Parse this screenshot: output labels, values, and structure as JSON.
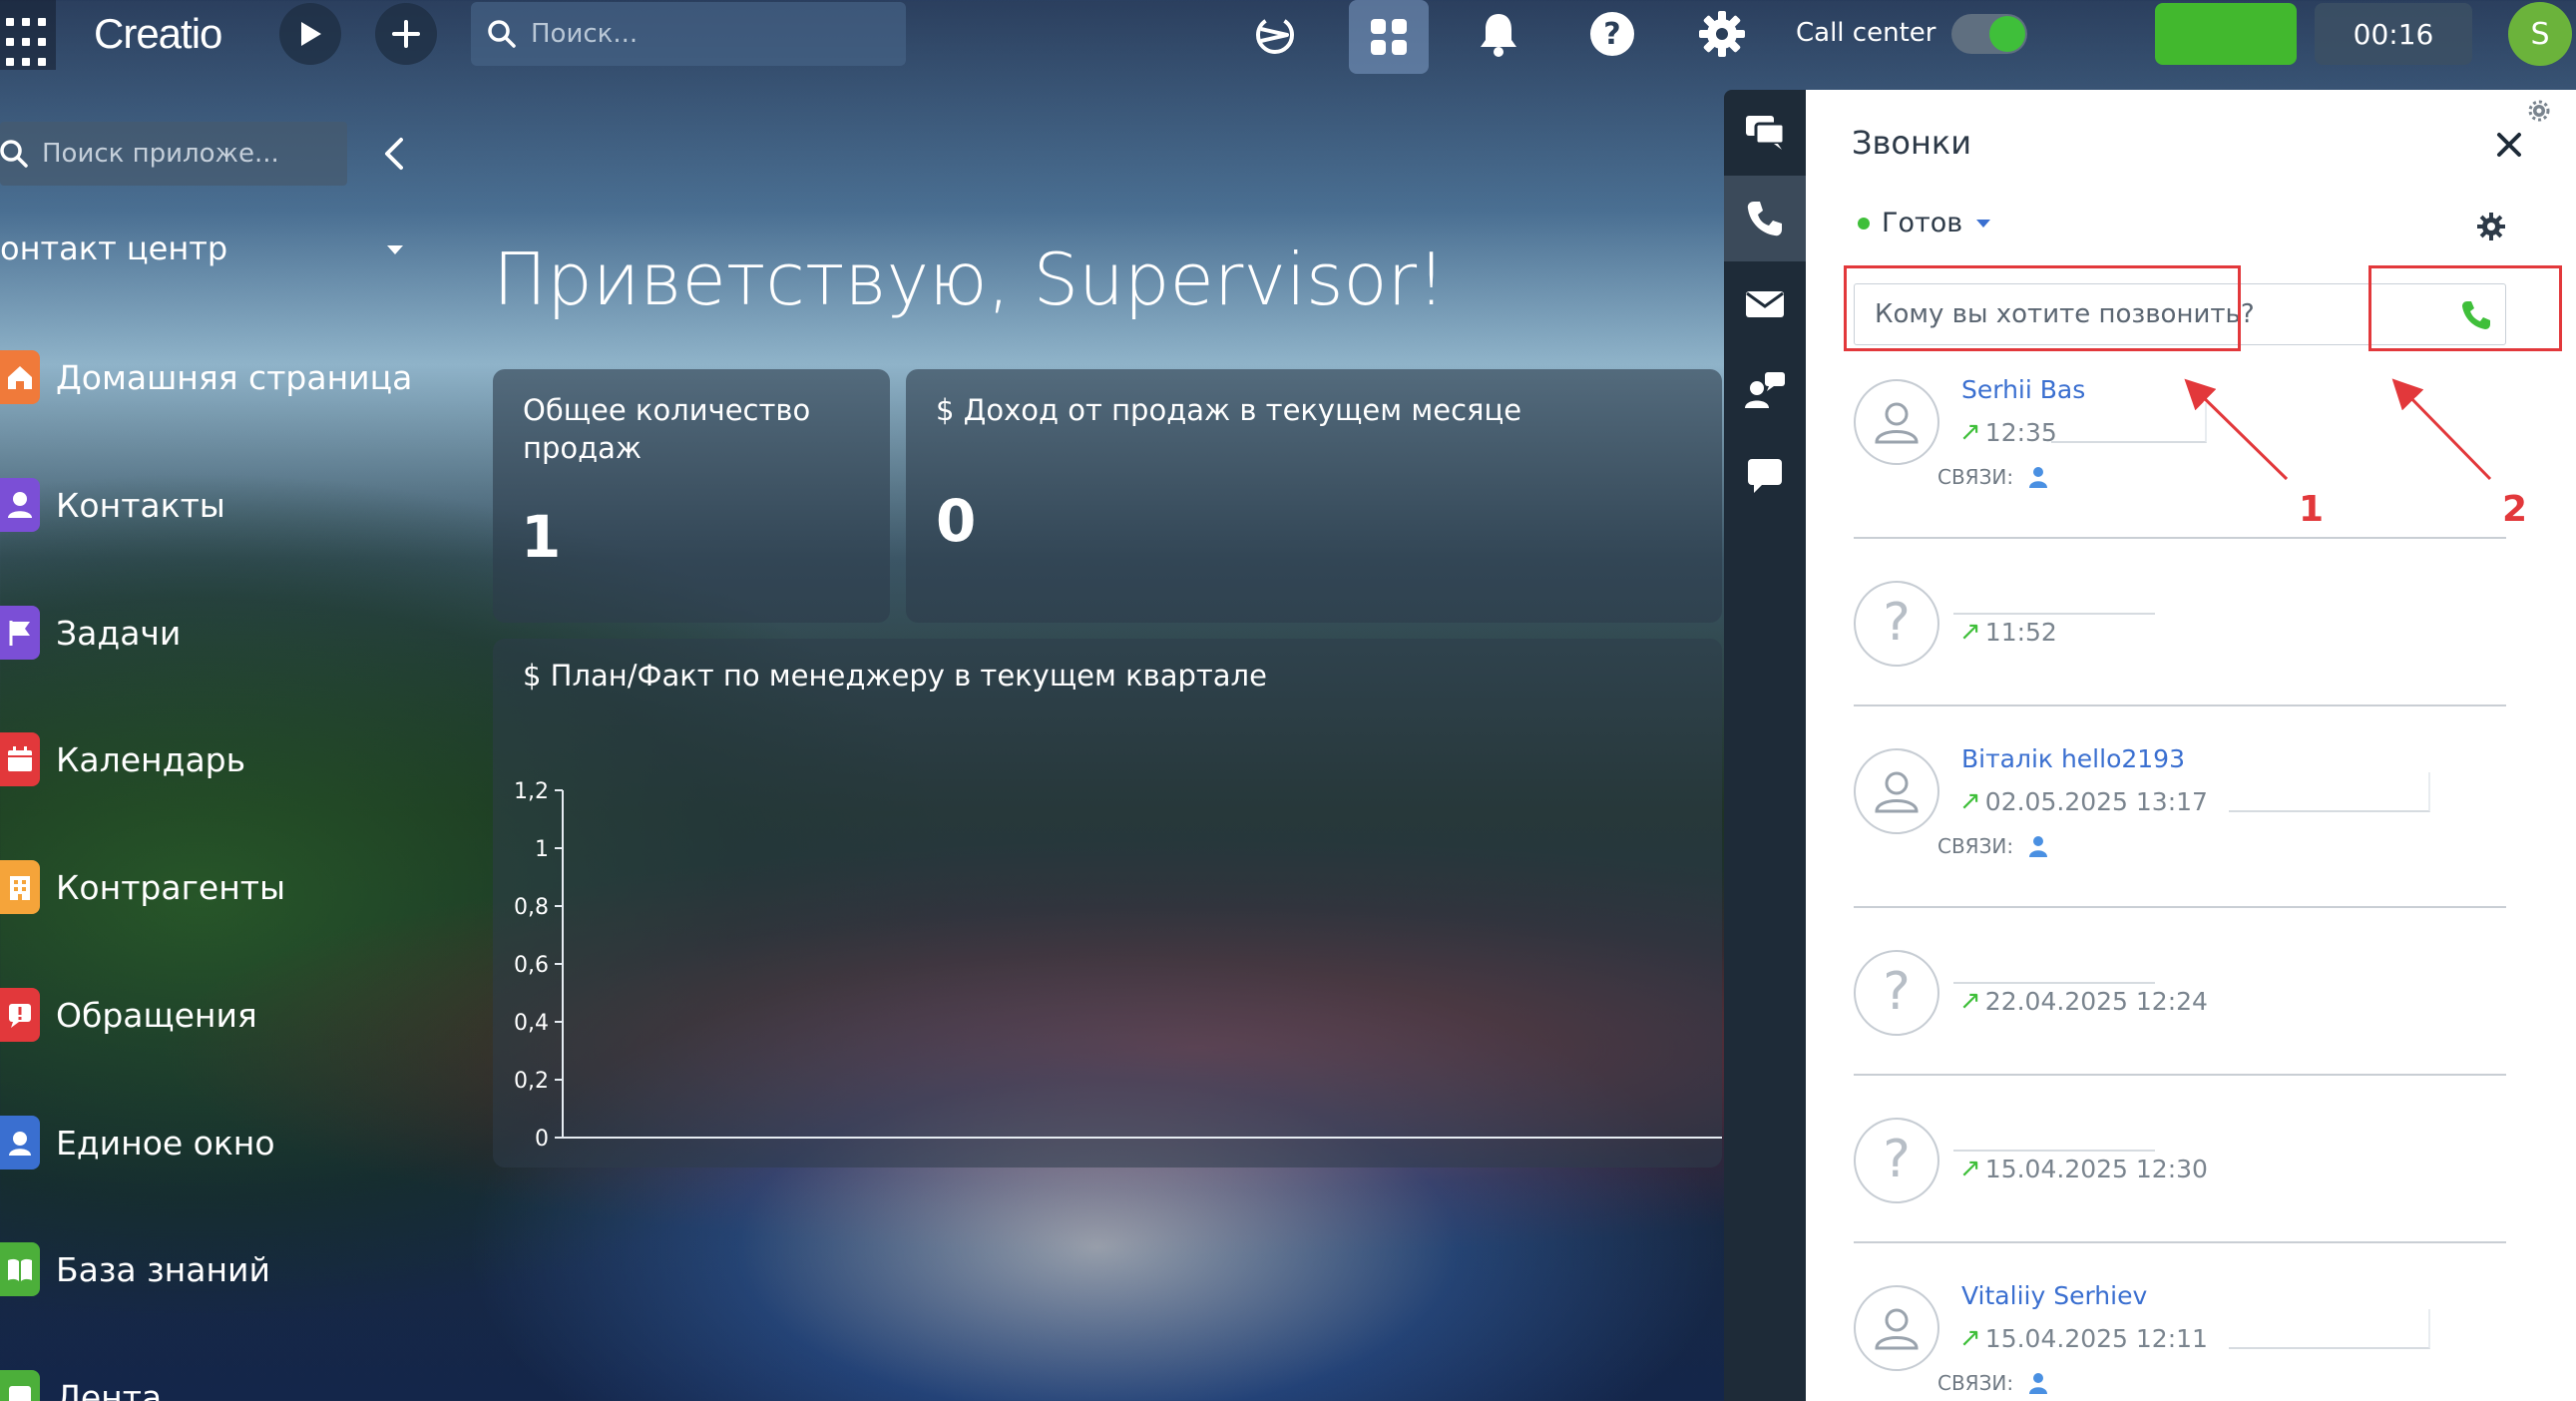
{
  "topbar": {
    "logo": "Creatio",
    "search_placeholder": "Поиск...",
    "call_center_label": "Call center",
    "call_center_enabled": true,
    "timer": "00:16",
    "user_initial": "S"
  },
  "sidebar": {
    "search_placeholder": "Поиск приложе...",
    "workplace": "онтакт центр",
    "items": [
      {
        "label": "Домашняя страница",
        "color": "#f07a3a",
        "icon": "home-icon"
      },
      {
        "label": "Контакты",
        "color": "#7b4fd6",
        "icon": "person-icon"
      },
      {
        "label": "Задачи",
        "color": "#7b4fd6",
        "icon": "flag-icon"
      },
      {
        "label": "Календарь",
        "color": "#e2383b",
        "icon": "calendar-icon"
      },
      {
        "label": "Контрагенты",
        "color": "#f5a43a",
        "icon": "building-icon"
      },
      {
        "label": "Обращения",
        "color": "#e2383b",
        "icon": "alert-icon"
      },
      {
        "label": "Единое окно",
        "color": "#3a6fd0",
        "icon": "agent-icon"
      },
      {
        "label": "База знаний",
        "color": "#4caf3a",
        "icon": "book-icon"
      },
      {
        "label": "Лента",
        "color": "#4caf3a",
        "icon": "feed-icon"
      }
    ]
  },
  "dashboard": {
    "greeting": "Приветствую, Supervisor!",
    "total_sales_title": "Общее количество продаж",
    "total_sales_value": "1",
    "revenue_title": "$ Доход от продаж в текущем месяце",
    "revenue_value": "0",
    "chart_title": "$ План/Факт по менеджеру в текущем квартале"
  },
  "chart_data": {
    "type": "bar",
    "title": "$ План/Факт по менеджеру в текущем квартале",
    "categories": [],
    "series": [],
    "yticks": [
      "0",
      "0,2",
      "0,4",
      "0,6",
      "0,8",
      "1",
      "1,2"
    ],
    "ylim": [
      0,
      1.2
    ],
    "xlabel": "",
    "ylabel": ""
  },
  "calls_panel": {
    "title": "Звонки",
    "status": "Готов",
    "dial_placeholder": "Кому вы хотите позвонить?",
    "links_label": "СВЯЗИ:",
    "annotations": [
      "1",
      "2"
    ],
    "calls": [
      {
        "name": "Serhii Bas",
        "time": "12:35",
        "known": true
      },
      {
        "name": "",
        "time": "11:52",
        "known": false
      },
      {
        "name": "Віталік hello2193",
        "time": "02.05.2025 13:17",
        "known": true
      },
      {
        "name": "",
        "time": "22.04.2025 12:24",
        "known": false
      },
      {
        "name": "",
        "time": "15.04.2025 12:30",
        "known": false
      },
      {
        "name": "Vitaliiy Serhiev",
        "time": "15.04.2025 12:11",
        "known": true
      }
    ]
  }
}
